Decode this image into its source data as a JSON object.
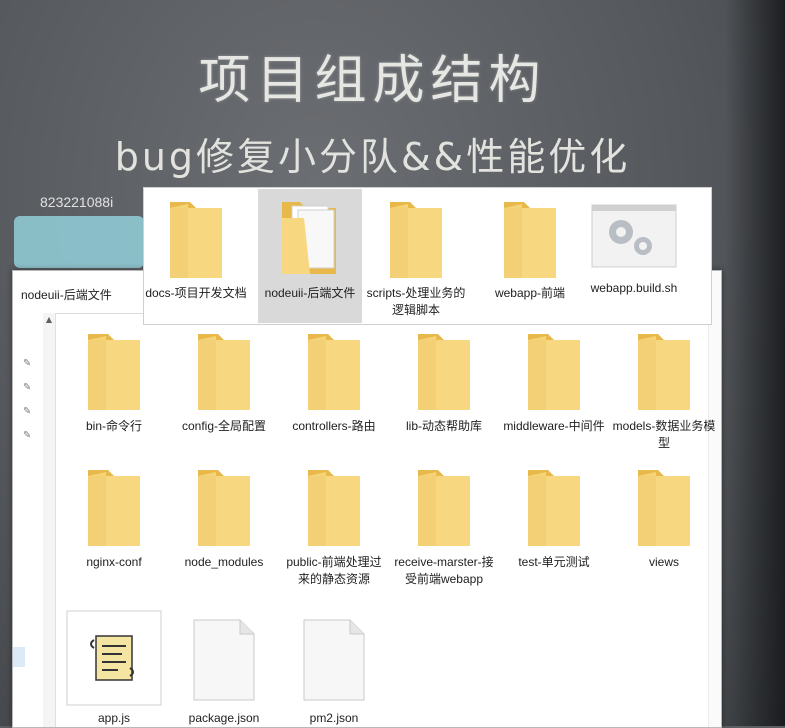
{
  "slide": {
    "title": "项目组成结构",
    "subtitle": "bug修复小分队&&性能优化",
    "watermark": "823221088і"
  },
  "back_window": {
    "address": "nodeuii-后端文件",
    "items": [
      {
        "label": "bin-命令行",
        "icon": "folder-icon"
      },
      {
        "label": "config-全局配置",
        "icon": "folder-icon"
      },
      {
        "label": "controllers-路由",
        "icon": "folder-icon"
      },
      {
        "label": "lib-动态帮助库",
        "icon": "folder-icon"
      },
      {
        "label": "middleware-中间件",
        "icon": "folder-icon"
      },
      {
        "label": "models-数据业务模型",
        "icon": "folder-icon"
      },
      {
        "label": "nginx-conf",
        "icon": "folder-icon"
      },
      {
        "label": "node_modules",
        "icon": "folder-icon"
      },
      {
        "label": "public-前端处理过来的静态资源",
        "icon": "folder-icon"
      },
      {
        "label": "receive-marster-接受前端webapp",
        "icon": "folder-icon"
      },
      {
        "label": "test-单元测试",
        "icon": "folder-icon"
      },
      {
        "label": "views",
        "icon": "folder-icon"
      },
      {
        "label": "app.js",
        "icon": "script-file-icon"
      },
      {
        "label": "package.json",
        "icon": "blank-file-icon"
      },
      {
        "label": "pm2.json",
        "icon": "blank-file-icon"
      }
    ]
  },
  "front_window": {
    "items": [
      {
        "label": "docs-项目开发文档",
        "icon": "folder-icon"
      },
      {
        "label": "nodeuii-后端文件",
        "icon": "open-folder-icon",
        "selected": true
      },
      {
        "label": "scripts-处理业务的逻辑脚本",
        "icon": "folder-icon"
      },
      {
        "label": "webapp-前端",
        "icon": "folder-icon"
      },
      {
        "label": "webapp.build.sh",
        "icon": "settings-file-icon"
      }
    ]
  },
  "colors": {
    "folder_back": "#e8b94a",
    "folder_front": "#f7d77f",
    "selection": "#d9d9d9",
    "slide_bg": "#5b5e63"
  }
}
